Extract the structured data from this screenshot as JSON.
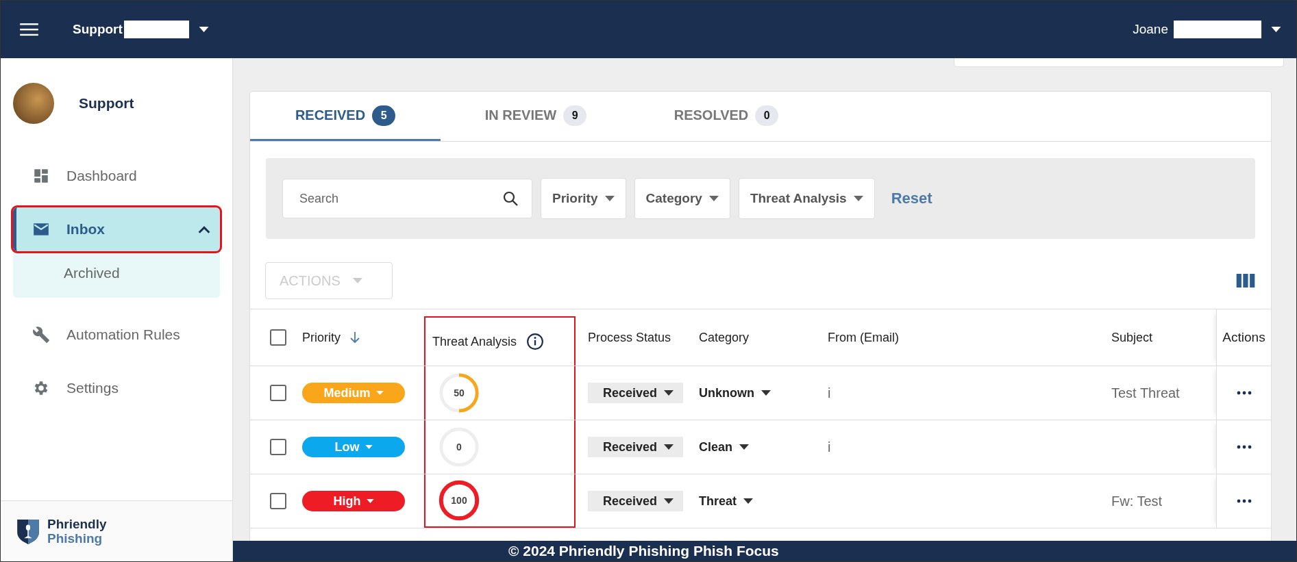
{
  "header": {
    "org": "Support",
    "user": "Joane"
  },
  "sidebar": {
    "profile": {
      "name": "Support"
    },
    "items": [
      {
        "label": "Dashboard",
        "selected": false,
        "highlighted": false
      },
      {
        "label": "Inbox",
        "selected": true,
        "highlighted": true,
        "expanded": true,
        "children": [
          {
            "label": "Archived",
            "selected": false
          }
        ]
      },
      {
        "label": "Automation Rules",
        "selected": false,
        "highlighted": false
      },
      {
        "label": "Settings",
        "selected": false,
        "highlighted": false
      }
    ],
    "logo": {
      "line1": "Phriendly",
      "line2": "Phishing"
    }
  },
  "tabs": [
    {
      "label": "RECEIVED",
      "count": "5",
      "selected": true
    },
    {
      "label": "IN REVIEW",
      "count": "9",
      "selected": false
    },
    {
      "label": "RESOLVED",
      "count": "0",
      "selected": false
    }
  ],
  "filters": {
    "search_placeholder": "Search",
    "dropdowns": [
      "Priority",
      "Category",
      "Threat Analysis"
    ],
    "reset": "Reset"
  },
  "actions_button": {
    "label": "ACTIONS",
    "disabled": true
  },
  "table": {
    "select_all_checked": false,
    "columns": [
      {
        "label": "Priority",
        "kind": "sort",
        "highlighted": false
      },
      {
        "label": "Threat Analysis",
        "kind": "info",
        "highlighted": true
      },
      {
        "label": "Process Status",
        "kind": "plain",
        "highlighted": false
      },
      {
        "label": "Category",
        "kind": "plain",
        "highlighted": false
      },
      {
        "label": "From (Email)",
        "kind": "plain",
        "highlighted": false
      },
      {
        "label": "Subject",
        "kind": "plain",
        "highlighted": false
      },
      {
        "label": "Actions",
        "kind": "pinned",
        "highlighted": false
      }
    ],
    "rows": [
      {
        "checked": false,
        "priority": "Medium",
        "color": "#f9a61a",
        "score": "50",
        "level": 0.5,
        "status": "Received",
        "category": "Unknown",
        "from": "i",
        "subject": "Test Threat"
      },
      {
        "checked": false,
        "priority": "Low",
        "color": "#0ba8ee",
        "score": "0",
        "level": 0,
        "status": "Received",
        "category": "Clean",
        "from": "i"
      },
      {
        "checked": false,
        "priority": "High",
        "color": "#ee1c24",
        "score": "100",
        "level": 1,
        "status": "Received",
        "category": "Threat",
        "subject": "Fw: Test"
      }
    ]
  },
  "footer": "© 2024 Phriendly Phishing Phish Focus"
}
